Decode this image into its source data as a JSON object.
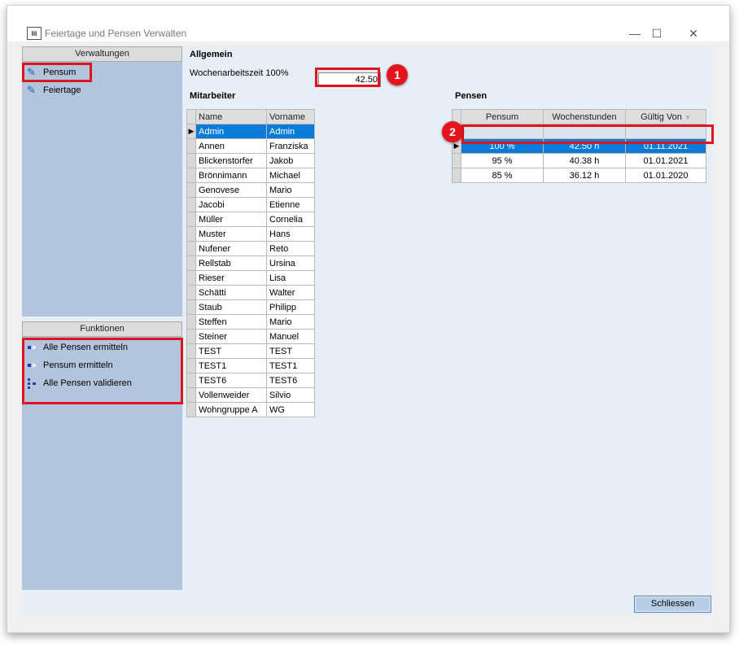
{
  "window": {
    "title": "Feiertage und Pensen Verwalten",
    "minimize": "—",
    "maximize": "☐",
    "close": "✕"
  },
  "left": {
    "verwaltungen_header": "Verwaltungen",
    "nav_items": [
      {
        "label": "Pensum"
      },
      {
        "label": "Feiertage"
      }
    ],
    "funktionen_header": "Funktionen",
    "functions": [
      {
        "label": "Alle Pensen ermitteln"
      },
      {
        "label": "Pensum ermitteln"
      },
      {
        "label": "Alle Pensen validieren"
      }
    ]
  },
  "allgemein": {
    "heading": "Allgemein",
    "wochenarbeitszeit_label": "Wochenarbeitszeit 100%",
    "wochenarbeitszeit_value": "42.50"
  },
  "mitarbeiter": {
    "heading": "Mitarbeiter",
    "columns": [
      "Name",
      "Vorname"
    ],
    "rows": [
      [
        "Admin",
        "Admin"
      ],
      [
        "Annen",
        "Franziska"
      ],
      [
        "Blickenstorfer",
        "Jakob"
      ],
      [
        "Brönnimann",
        "Michael"
      ],
      [
        "Genovese",
        "Mario"
      ],
      [
        "Jacobi",
        "Etienne"
      ],
      [
        "Müller",
        "Cornelia"
      ],
      [
        "Muster",
        "Hans"
      ],
      [
        "Nufener",
        "Reto"
      ],
      [
        "Rellstab",
        "Ursina"
      ],
      [
        "Rieser",
        "Lisa"
      ],
      [
        "Schätti",
        "Walter"
      ],
      [
        "Staub",
        "Philipp"
      ],
      [
        "Steffen",
        "Mario"
      ],
      [
        "Steiner",
        "Manuel"
      ],
      [
        "TEST",
        "TEST"
      ],
      [
        "TEST1",
        "TEST1"
      ],
      [
        "TEST6",
        "TEST6"
      ],
      [
        "Vollenweider",
        "Silvio"
      ],
      [
        "Wohngruppe A",
        "WG"
      ]
    ]
  },
  "pensen": {
    "heading": "Pensen",
    "columns": [
      "Pensum",
      "Wochenstunden",
      "Gültig Von"
    ],
    "rows": [
      [
        "100 %",
        "42.50 h",
        "01.11.2021"
      ],
      [
        "95 %",
        "40.38 h",
        "01.01.2021"
      ],
      [
        "85 %",
        "36.12 h",
        "01.01.2020"
      ]
    ]
  },
  "annotations": {
    "badge1": "1",
    "badge2": "2"
  },
  "buttons": {
    "schliessen": "Schliessen"
  }
}
